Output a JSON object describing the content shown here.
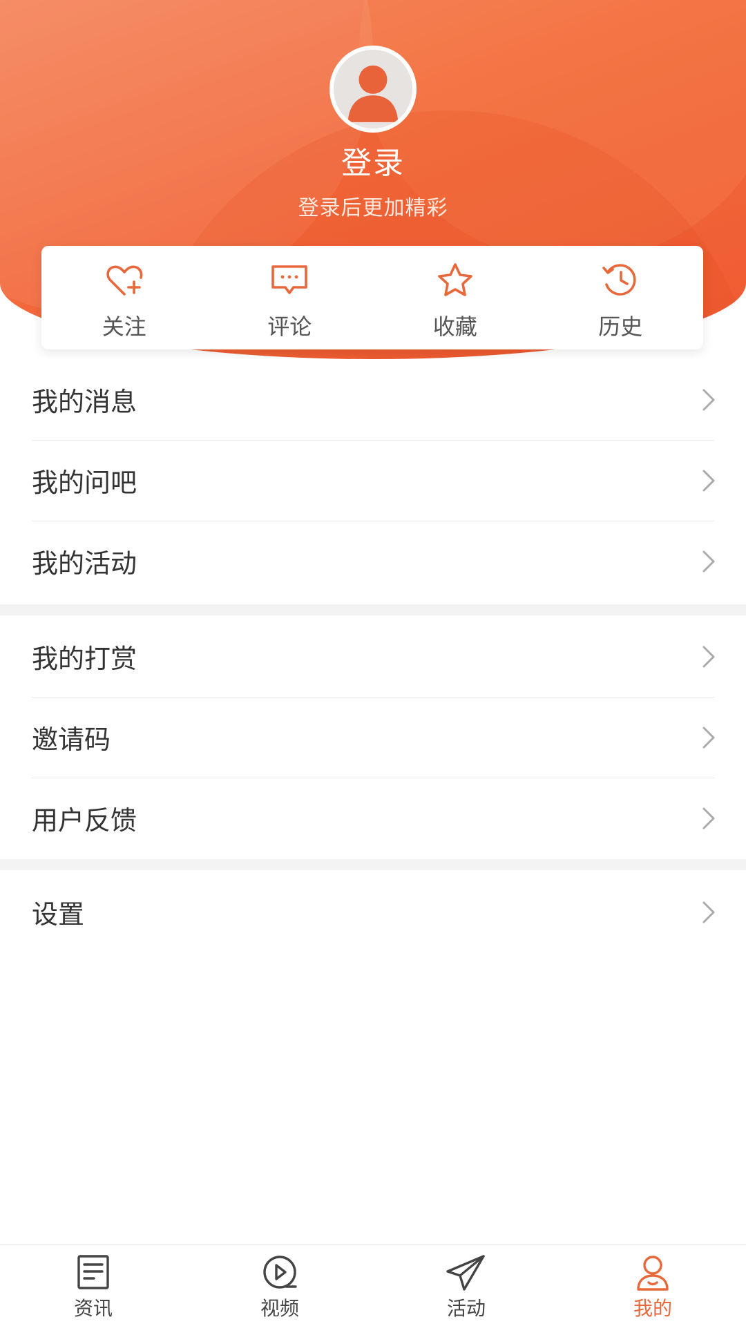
{
  "colors": {
    "accent": "#ee6a3c",
    "header_top": "#f5845a",
    "header_bottom": "#ef5a32",
    "text_primary": "#333333",
    "chevron": "#aaaaaa"
  },
  "profile": {
    "title": "登录",
    "subtitle": "登录后更加精彩",
    "avatar_icon": "user-avatar-icon"
  },
  "quick_actions": [
    {
      "label": "关注",
      "icon": "heart-plus-icon"
    },
    {
      "label": "评论",
      "icon": "comment-icon"
    },
    {
      "label": "收藏",
      "icon": "star-icon"
    },
    {
      "label": "历史",
      "icon": "history-icon"
    }
  ],
  "menu_groups": [
    [
      {
        "label": "我的消息"
      },
      {
        "label": "我的问吧"
      },
      {
        "label": "我的活动"
      }
    ],
    [
      {
        "label": "我的打赏"
      },
      {
        "label": "邀请码"
      },
      {
        "label": "用户反馈"
      }
    ],
    [
      {
        "label": "设置"
      }
    ]
  ],
  "tabs": [
    {
      "label": "资讯",
      "icon": "news-icon",
      "active": false
    },
    {
      "label": "视频",
      "icon": "video-icon",
      "active": false
    },
    {
      "label": "活动",
      "icon": "paper-plane-icon",
      "active": false
    },
    {
      "label": "我的",
      "icon": "profile-icon",
      "active": true
    }
  ]
}
